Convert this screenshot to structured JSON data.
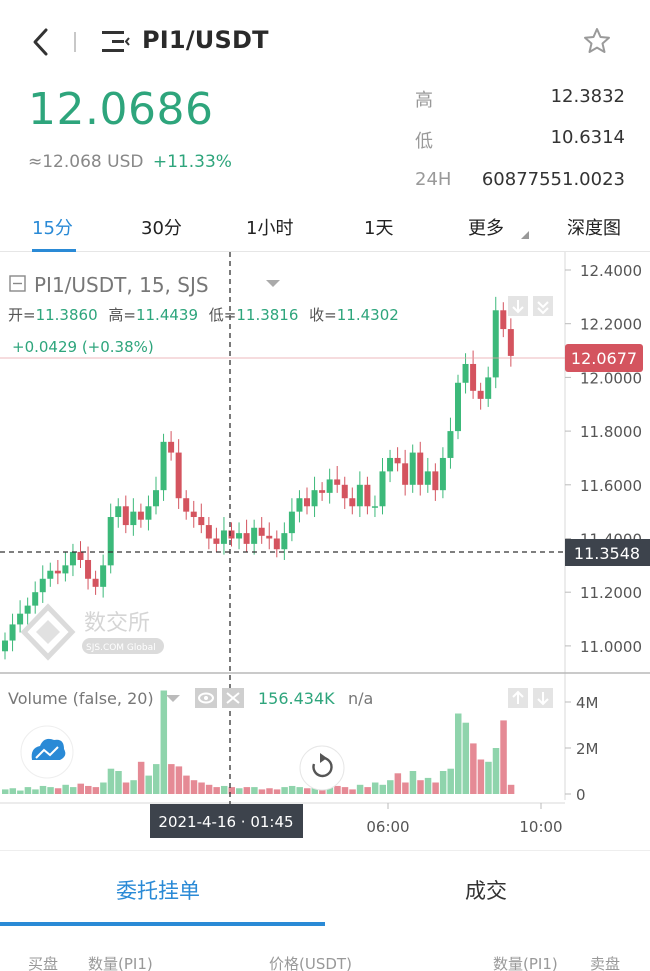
{
  "header": {
    "title": "PI1/USDT"
  },
  "price": {
    "last": "12.0686",
    "usd": "≈12.068 USD",
    "change": "+11.33%"
  },
  "stats": [
    {
      "label": "高",
      "value": "12.3832"
    },
    {
      "label": "低",
      "value": "10.6314"
    },
    {
      "label": "24H",
      "value": "60877551.0023"
    }
  ],
  "intervals": [
    "15分",
    "30分",
    "1小时",
    "1天",
    "更多",
    "深度图"
  ],
  "active_interval": "15分",
  "chart": {
    "legend": "PI1/USDT, 15, SJS",
    "ohlc": {
      "open_label": "开=",
      "open": "11.3860",
      "high_label": "高=",
      "high": "11.4439",
      "low_label": "低=",
      "low": "11.3816",
      "close_label": "收=",
      "close": "11.4302"
    },
    "change_line": "+0.0429 (+0.38%)",
    "price_ticks": [
      "12.4000",
      "12.2000",
      "12.0000",
      "11.8000",
      "11.6000",
      "11.4000",
      "11.2000",
      "11.0000"
    ],
    "current_price_tag": "12.0677",
    "crosshair_price_tag": "11.3548",
    "watermark_cn": "数交所",
    "watermark_en": "SJS.COM Global",
    "volume_legend": "Volume (false, 20)",
    "volume_value": "156.434K",
    "volume_na": "n/a",
    "volume_ticks": [
      "4M",
      "2M",
      "0"
    ],
    "time_ticks": [
      "06:00",
      "10:00"
    ],
    "crosshair_time": "2021-4-16 · 01:45",
    "colors": {
      "up": "#8fd4ac",
      "down": "#e58a95",
      "up_solid": "#3cb97a",
      "down_solid": "#d4545f"
    }
  },
  "book": {
    "tabs": [
      "委托挂单",
      "成交"
    ],
    "headers": [
      "买盘",
      "数量(PI1)",
      "价格(USDT)",
      "数量(PI1)",
      "卖盘"
    ]
  }
}
